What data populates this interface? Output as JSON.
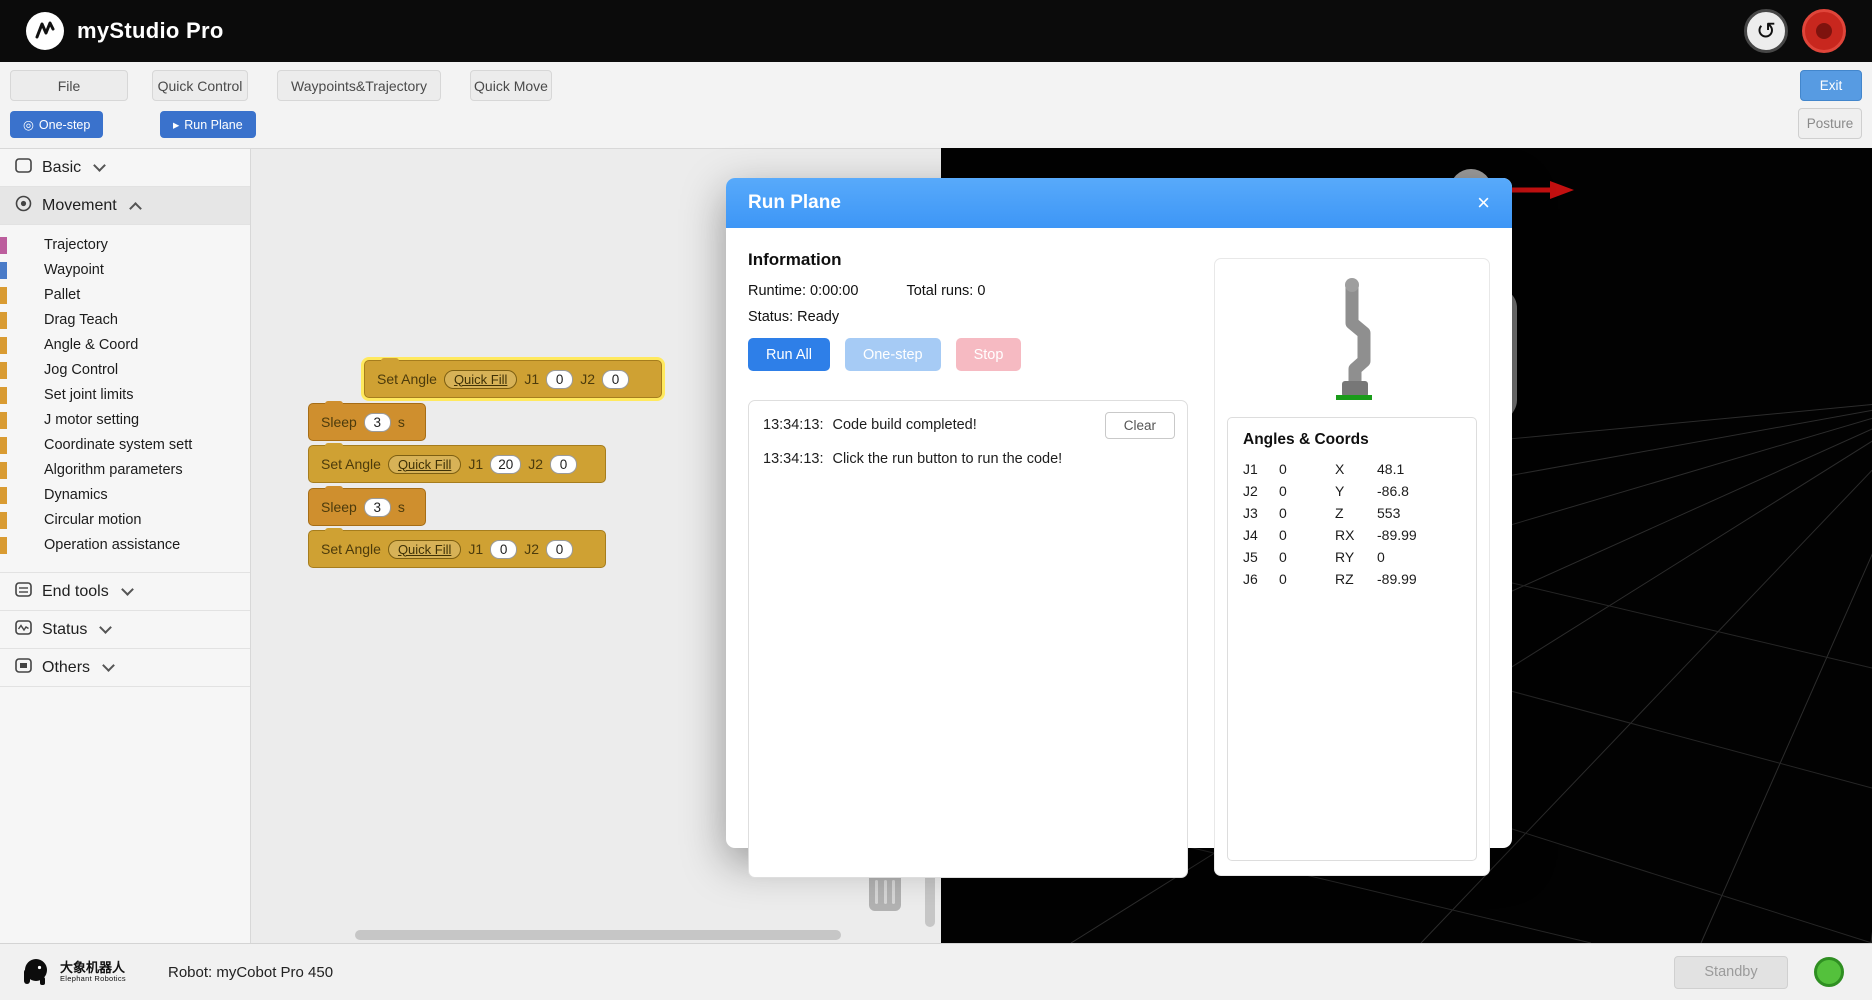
{
  "app": {
    "title": "myStudio Pro"
  },
  "icons": {
    "undo": "↺",
    "one_step": "◎",
    "run_plane": "▸"
  },
  "menubar": {
    "file": "File",
    "quick_control": "Quick Control",
    "waypoints": "Waypoints&Trajectory",
    "quick_move": "Quick Move",
    "exit": "Exit"
  },
  "toolbar": {
    "one_step": "One-step",
    "run_plane": "Run Plane",
    "posture": "Posture"
  },
  "sidebar": {
    "categories": [
      {
        "label": "Basic"
      },
      {
        "label": "Movement"
      },
      {
        "label": "End tools"
      },
      {
        "label": "Status"
      },
      {
        "label": "Others"
      }
    ],
    "movement_items": [
      {
        "label": "Trajectory",
        "color": "#bc5e9d"
      },
      {
        "label": "Waypoint",
        "color": "#4a7bc8"
      },
      {
        "label": "Pallet",
        "color": "#d99b32"
      },
      {
        "label": "Drag Teach",
        "color": "#d99b32"
      },
      {
        "label": "Angle & Coord",
        "color": "#d99b32"
      },
      {
        "label": "Jog Control",
        "color": "#d99b32"
      },
      {
        "label": "Set joint limits",
        "color": "#d99b32"
      },
      {
        "label": "J motor setting",
        "color": "#d99b32"
      },
      {
        "label": "Coordinate system sett",
        "color": "#d99b32"
      },
      {
        "label": "Algorithm parameters",
        "color": "#d99b32"
      },
      {
        "label": "Dynamics",
        "color": "#d99b32"
      },
      {
        "label": "Circular motion",
        "color": "#d99b32"
      },
      {
        "label": "Operation assistance",
        "color": "#d99b32"
      }
    ]
  },
  "canvas": {
    "blocks": [
      {
        "kind": "set_angle",
        "label": "Set Angle",
        "quick_fill": "Quick Fill",
        "j1_label": "J1",
        "j1_value": "0",
        "j2_label": "J2",
        "j2_value": "0"
      },
      {
        "kind": "sleep",
        "label": "Sleep",
        "value": "3",
        "unit": "s"
      },
      {
        "kind": "set_angle",
        "label": "Set Angle",
        "quick_fill": "Quick Fill",
        "j1_label": "J1",
        "j1_value": "20",
        "j2_label": "J2",
        "j2_value": "0"
      },
      {
        "kind": "sleep",
        "label": "Sleep",
        "value": "3",
        "unit": "s"
      },
      {
        "kind": "set_angle",
        "label": "Set Angle",
        "quick_fill": "Quick Fill",
        "j1_label": "J1",
        "j1_value": "0",
        "j2_label": "J2",
        "j2_value": "0"
      }
    ]
  },
  "modal": {
    "title": "Run Plane",
    "close": "×",
    "info_heading": "Information",
    "runtime": "Runtime: 0:00:00",
    "total_runs": "Total runs: 0",
    "status": "Status: Ready",
    "run_all": "Run All",
    "one_step": "One-step",
    "stop": "Stop",
    "clear": "Clear",
    "log": [
      {
        "time": "13:34:13:",
        "message": "Code build completed!"
      },
      {
        "time": "13:34:13:",
        "message": "Click the run button to run the code!"
      }
    ],
    "angles_heading": "Angles & Coords",
    "angles": [
      {
        "joint": "J1",
        "joint_value": "0",
        "coord": "X",
        "coord_value": "48.1"
      },
      {
        "joint": "J2",
        "joint_value": "0",
        "coord": "Y",
        "coord_value": "-86.8"
      },
      {
        "joint": "J3",
        "joint_value": "0",
        "coord": "Z",
        "coord_value": "553"
      },
      {
        "joint": "J4",
        "joint_value": "0",
        "coord": "RX",
        "coord_value": "-89.99"
      },
      {
        "joint": "J5",
        "joint_value": "0",
        "coord": "RY",
        "coord_value": "0"
      },
      {
        "joint": "J6",
        "joint_value": "0",
        "coord": "RZ",
        "coord_value": "-89.99"
      }
    ]
  },
  "statusbar": {
    "brand_cn": "大象机器人",
    "brand_en": "Elephant Robotics",
    "robot": "Robot: myCobot Pro 450",
    "standby": "Standby"
  },
  "colors": {
    "modal_header": "#4aa0f8",
    "run_all": "#2e7fe8",
    "one_step_disabled": "#a6cbf5",
    "stop_disabled": "#f6bac2",
    "status_green": "#54c13c"
  }
}
